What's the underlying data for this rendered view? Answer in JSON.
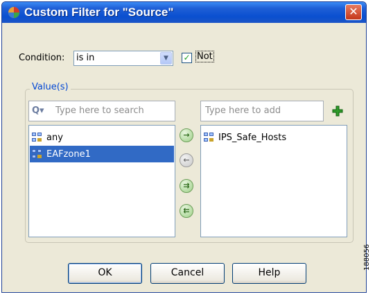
{
  "window": {
    "title": "Custom Filter for \"Source\"",
    "close_glyph": "✕",
    "accent": "#0a4fd0"
  },
  "condition": {
    "label": "Condition:",
    "selected": "is in",
    "dropdown_glyph": "▼",
    "not_checked": true,
    "not_label": "Not",
    "check_glyph": "✓"
  },
  "values_group": {
    "title": "Value(s)",
    "search": {
      "icon_text": "Q▾",
      "placeholder": "Type here to search"
    },
    "add_input": {
      "placeholder": "Type here to add"
    },
    "available": [
      {
        "label": "any",
        "icon": "network-object-icon",
        "selected": false
      },
      {
        "label": "EAFzone1",
        "icon": "network-object-icon",
        "selected": true
      }
    ],
    "chosen": [
      {
        "label": "IPS_Safe_Hosts",
        "icon": "network-object-icon",
        "selected": false
      }
    ],
    "move_buttons": [
      {
        "glyph": "→",
        "name": "move-right-icon",
        "enabled": true
      },
      {
        "glyph": "←",
        "name": "move-left-icon",
        "enabled": false
      },
      {
        "glyph": "⇉",
        "name": "move-all-right-icon",
        "enabled": true
      },
      {
        "glyph": "⇇",
        "name": "move-all-left-icon",
        "enabled": true
      }
    ]
  },
  "buttons": {
    "ok": "OK",
    "cancel": "Cancel",
    "help": "Help"
  },
  "side_number": "188056"
}
